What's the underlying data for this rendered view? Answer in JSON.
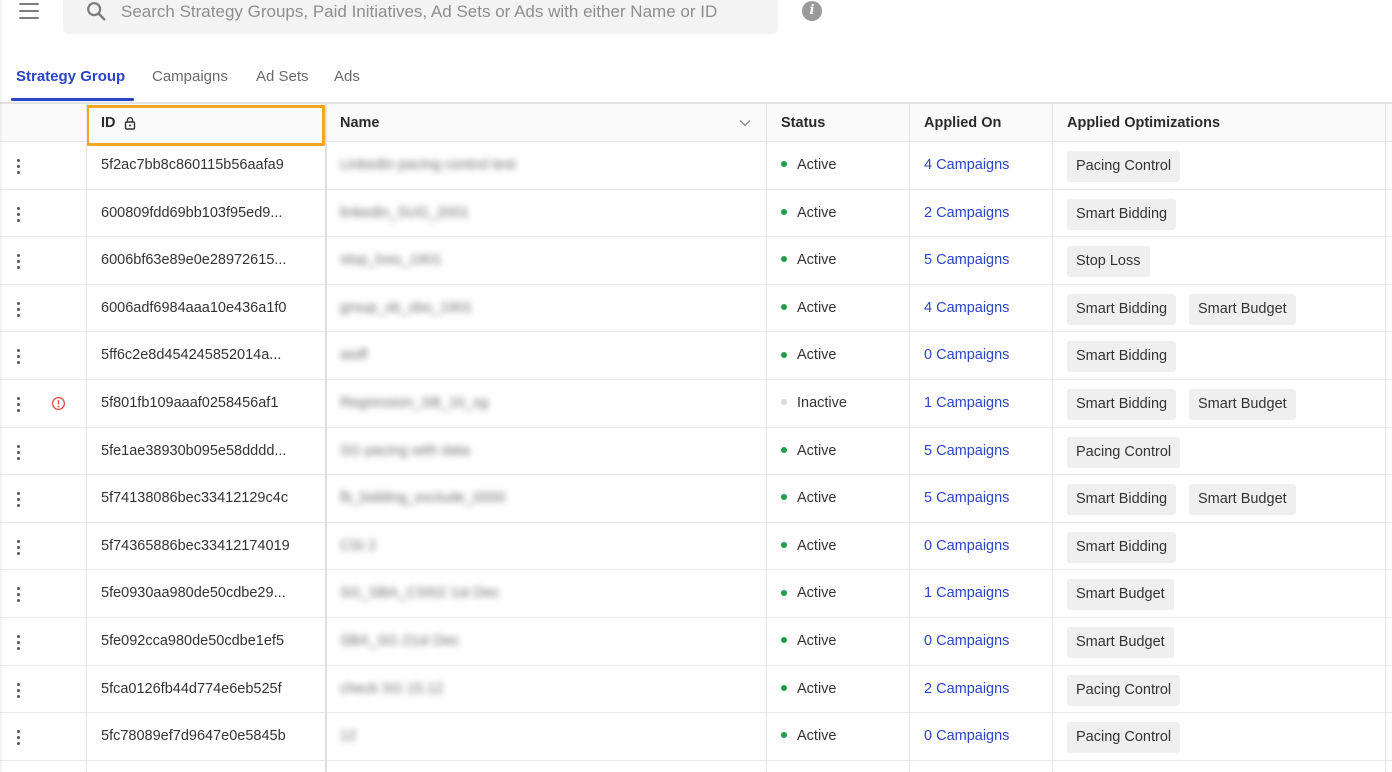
{
  "search": {
    "placeholder": "Search Strategy Groups, Paid Initiatives, Ad Sets or Ads with either Name or ID"
  },
  "tabs": [
    {
      "label": "Strategy Group",
      "active": true
    },
    {
      "label": "Campaigns",
      "active": false
    },
    {
      "label": "Ad Sets",
      "active": false
    },
    {
      "label": "Ads",
      "active": false
    }
  ],
  "table": {
    "headers": {
      "id": "ID",
      "name": "Name",
      "status": "Status",
      "applied_on": "Applied On",
      "applied_optimizations": "Applied Optimizations"
    },
    "rows": [
      {
        "id": "5f2ac7bb8c860115b56aafa9",
        "name": "Linkedin pacing control test",
        "status": "Active",
        "applied_on": "4 Campaigns",
        "optimizations": [
          "Pacing Control"
        ],
        "alert": false
      },
      {
        "id": "600809fdd69bb103f95ed9...",
        "name": "linkedin_SUG_2001",
        "status": "Active",
        "applied_on": "2 Campaigns",
        "optimizations": [
          "Smart Bidding"
        ],
        "alert": false
      },
      {
        "id": "6006bf63e89e0e28972615...",
        "name": "stop_loss_1901",
        "status": "Active",
        "applied_on": "5 Campaigns",
        "optimizations": [
          "Stop Loss"
        ],
        "alert": false
      },
      {
        "id": "6006adf6984aaa10e436a1f0",
        "name": "group_sb_sbo_1901",
        "status": "Active",
        "applied_on": "4 Campaigns",
        "optimizations": [
          "Smart Bidding",
          "Smart Budget"
        ],
        "alert": false
      },
      {
        "id": "5ff6c2e8d454245852014a...",
        "name": "asdf",
        "status": "Active",
        "applied_on": "0 Campaigns",
        "optimizations": [
          "Smart Bidding"
        ],
        "alert": false
      },
      {
        "id": "5f801fb109aaaf0258456af1",
        "name": "Regression_SB_10_sg",
        "status": "Inactive",
        "applied_on": "1 Campaigns",
        "optimizations": [
          "Smart Bidding",
          "Smart Budget"
        ],
        "alert": true
      },
      {
        "id": "5fe1ae38930b095e58dddd...",
        "name": "SG pacing with data",
        "status": "Active",
        "applied_on": "5 Campaigns",
        "optimizations": [
          "Pacing Control"
        ],
        "alert": false
      },
      {
        "id": "5f74138086bec33412129c4c",
        "name": "fb_bidding_exclude_0000",
        "status": "Active",
        "applied_on": "5 Campaigns",
        "optimizations": [
          "Smart Bidding",
          "Smart Budget"
        ],
        "alert": false
      },
      {
        "id": "5f74365886bec33412174019",
        "name": "CSI 2",
        "status": "Active",
        "applied_on": "0 Campaigns",
        "optimizations": [
          "Smart Bidding"
        ],
        "alert": false
      },
      {
        "id": "5fe0930aa980de50cdbe29...",
        "name": "SG_SBA_CSI02 1st Dec",
        "status": "Active",
        "applied_on": "1 Campaigns",
        "optimizations": [
          "Smart Budget"
        ],
        "alert": false
      },
      {
        "id": "5fe092cca980de50cdbe1ef5",
        "name": "SBA_SG 21st Dec",
        "status": "Active",
        "applied_on": "0 Campaigns",
        "optimizations": [
          "Smart Budget"
        ],
        "alert": false
      },
      {
        "id": "5fca0126fb44d774e6eb525f",
        "name": "check SG 15.12",
        "status": "Active",
        "applied_on": "2 Campaigns",
        "optimizations": [
          "Pacing Control"
        ],
        "alert": false
      },
      {
        "id": "5fc78089ef7d9647e0e5845b",
        "name": "12",
        "status": "Active",
        "applied_on": "0 Campaigns",
        "optimizations": [
          "Pacing Control"
        ],
        "alert": false
      }
    ]
  },
  "colors": {
    "accent": "#2c44c6",
    "active_dot": "#1e9e4a",
    "inactive_dot": "#d9d9d9",
    "highlight_border": "#f5a623",
    "alert": "#e0453a"
  },
  "icons": {
    "menu": "hamburger-menu-icon",
    "search": "search-icon",
    "info": "info-icon",
    "lock": "lock-icon",
    "sort": "chevron-down-icon",
    "row_menu": "kebab-menu-icon",
    "alert": "alert-circle-icon"
  }
}
